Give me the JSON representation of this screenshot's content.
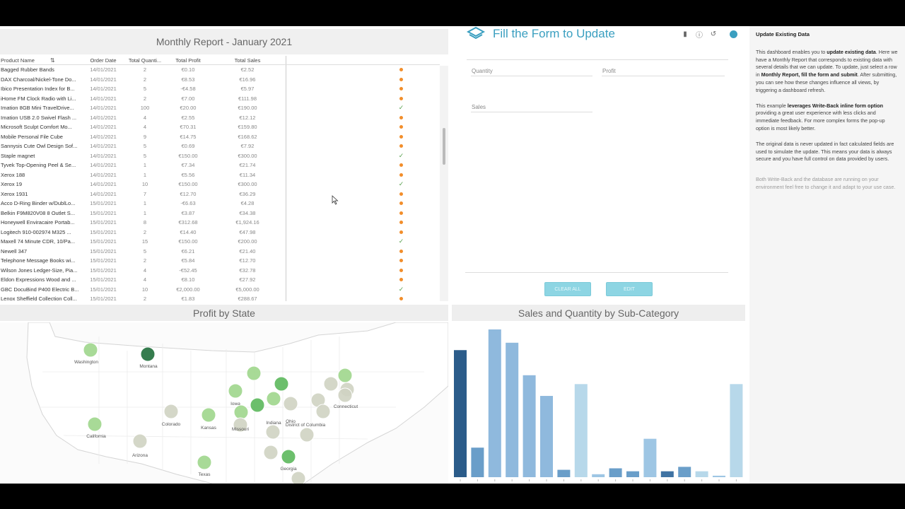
{
  "report": {
    "title": "Monthly Report  - January 2021",
    "columns": [
      "Product Name",
      "Order Date",
      "Total Quanti...",
      "Total Profit",
      "Total Sales"
    ],
    "rows": [
      {
        "name": "Bagged Rubber Bands",
        "date": "14/01/2021",
        "qty": "2",
        "profit": "€0.10",
        "sales": "€2.52",
        "status": "dot"
      },
      {
        "name": "DAX Charcoal/Nickel-Tone Do...",
        "date": "14/01/2021",
        "qty": "2",
        "profit": "€8.53",
        "sales": "€16.96",
        "status": "dot"
      },
      {
        "name": "Ibico Presentation Index for B...",
        "date": "14/01/2021",
        "qty": "5",
        "profit": "-€4.58",
        "sales": "€5.97",
        "status": "dot"
      },
      {
        "name": "iHome FM Clock Radio with Li...",
        "date": "14/01/2021",
        "qty": "2",
        "profit": "€7.00",
        "sales": "€111.98",
        "status": "dot"
      },
      {
        "name": "Imation 8GB Mini TravelDrive...",
        "date": "14/01/2021",
        "qty": "100",
        "profit": "€20.00",
        "sales": "€190.00",
        "status": "check"
      },
      {
        "name": "Imation USB 2.0 Swivel Flash ...",
        "date": "14/01/2021",
        "qty": "4",
        "profit": "€2.55",
        "sales": "€12.12",
        "status": "dot"
      },
      {
        "name": "Microsoft Sculpt Comfort Mo...",
        "date": "14/01/2021",
        "qty": "4",
        "profit": "€70.31",
        "sales": "€159.80",
        "status": "dot"
      },
      {
        "name": "Mobile Personal File Cube",
        "date": "14/01/2021",
        "qty": "9",
        "profit": "€14.75",
        "sales": "€168.62",
        "status": "dot"
      },
      {
        "name": "Sannysis Cute Owl Design Sof...",
        "date": "14/01/2021",
        "qty": "5",
        "profit": "€0.69",
        "sales": "€7.92",
        "status": "dot"
      },
      {
        "name": "Staple magnet",
        "date": "14/01/2021",
        "qty": "5",
        "profit": "€150.00",
        "sales": "€300.00",
        "status": "check"
      },
      {
        "name": "Tyvek  Top-Opening Peel & Se...",
        "date": "14/01/2021",
        "qty": "1",
        "profit": "€7.34",
        "sales": "€21.74",
        "status": "dot"
      },
      {
        "name": "Xerox 188",
        "date": "14/01/2021",
        "qty": "1",
        "profit": "€5.56",
        "sales": "€11.34",
        "status": "dot"
      },
      {
        "name": "Xerox 19",
        "date": "14/01/2021",
        "qty": "10",
        "profit": "€150.00",
        "sales": "€300.00",
        "status": "check"
      },
      {
        "name": "Xerox 1931",
        "date": "14/01/2021",
        "qty": "7",
        "profit": "€12.70",
        "sales": "€36.29",
        "status": "dot"
      },
      {
        "name": "Acco D-Ring Binder w/DublLo...",
        "date": "15/01/2021",
        "qty": "1",
        "profit": "-€6.63",
        "sales": "€4.28",
        "status": "dot"
      },
      {
        "name": "Belkin F9M820V08 8 Outlet S...",
        "date": "15/01/2021",
        "qty": "1",
        "profit": "€3.87",
        "sales": "€34.38",
        "status": "dot"
      },
      {
        "name": "Honeywell Enviracaire Portab...",
        "date": "15/01/2021",
        "qty": "8",
        "profit": "€312.68",
        "sales": "€1,924.16",
        "status": "dot"
      },
      {
        "name": "Logitech 910-002974 M325 ...",
        "date": "15/01/2021",
        "qty": "2",
        "profit": "€14.40",
        "sales": "€47.98",
        "status": "dot"
      },
      {
        "name": "Maxell 74 Minute CDR, 10/Pa...",
        "date": "15/01/2021",
        "qty": "15",
        "profit": "€150.00",
        "sales": "€200.00",
        "status": "check"
      },
      {
        "name": "Newell 347",
        "date": "15/01/2021",
        "qty": "5",
        "profit": "€6.21",
        "sales": "€21.40",
        "status": "dot"
      },
      {
        "name": "Telephone Message Books wi...",
        "date": "15/01/2021",
        "qty": "2",
        "profit": "€5.84",
        "sales": "€12.70",
        "status": "dot"
      },
      {
        "name": "Wilson Jones Ledger-Size, Pia...",
        "date": "15/01/2021",
        "qty": "4",
        "profit": "-€52.45",
        "sales": "€32.78",
        "status": "dot"
      },
      {
        "name": "Eldon Expressions Wood and ...",
        "date": "15/01/2021",
        "qty": "4",
        "profit": "€8.10",
        "sales": "€27.92",
        "status": "dot"
      },
      {
        "name": "GBC DocuBind P400 Electric B...",
        "date": "15/01/2021",
        "qty": "10",
        "profit": "€2,000.00",
        "sales": "€5,000.00",
        "status": "check"
      },
      {
        "name": "Lenox Sheffield Collection Coll...",
        "date": "15/01/2021",
        "qty": "2",
        "profit": "€1.83",
        "sales": "€288.67",
        "status": "dot"
      }
    ]
  },
  "form": {
    "title": "Fill the Form to Update",
    "fields": {
      "quantity": "Quantity",
      "profit": "Profit",
      "sales": "Sales"
    },
    "clear_label": "CLEAR ALL",
    "submit_label": "EDIT"
  },
  "info": {
    "title": "Update Existing Data",
    "p1_a": "This dashboard enables you to ",
    "p1_b": "update existing data",
    "p1_c": ". Here we have a Monthly Report that corresponds to existing data with several details that we can update. To update, just select a row in ",
    "p1_d": "Monthly Report, fill the form and submit",
    "p1_e": ". After submitting, you can see how these changes influence all views, by triggering a dashboard refresh.",
    "p2_a": "This example ",
    "p2_b": "leverages Write-Back inline form option",
    "p2_c": " providing a great user experience with less clicks and immediate feedback. For more complex forms the pop-up option is most likely better.",
    "p3": "The original data is never updated in fact calculated fields are used to simulate the update. This means your data is always secure and you have full control on data provided by users.",
    "p4": "Both Write-Back and the database are running on your environment feel free to change it and adapt to your use case."
  },
  "map": {
    "title": "Profit by State",
    "labels": [
      {
        "text": "Washington"
      },
      {
        "text": "Montana"
      },
      {
        "text": "Iowa"
      },
      {
        "text": "Indiana"
      },
      {
        "text": "Ohio"
      },
      {
        "text": "Connecticut"
      },
      {
        "text": "Colorado"
      },
      {
        "text": "Kansas"
      },
      {
        "text": "Missouri"
      },
      {
        "text": "District of Columbia"
      },
      {
        "text": "California"
      },
      {
        "text": "Arizona"
      },
      {
        "text": "Georgia"
      },
      {
        "text": "Texas"
      }
    ],
    "colors": {
      "light": "#9fd68c",
      "mid": "#5cb85c",
      "dark": "#1f6e3b",
      "neutral": "#cfd3c2"
    }
  },
  "bars": {
    "title": "Sales and Quantity by Sub-Category"
  },
  "chart_data": {
    "type": "bar",
    "title": "Sales and Quantity by Sub-Category",
    "values": [
      0.86,
      0.2,
      1.0,
      0.91,
      0.69,
      0.55,
      0.05,
      0.63,
      0.02,
      0.06,
      0.04,
      0.26,
      0.04,
      0.07,
      0.04,
      0.01,
      0.63
    ],
    "colors": [
      "#2b5c8a",
      "#6a9ec9",
      "#8fb9dd",
      "#8fb9dd",
      "#8fb9dd",
      "#8fb9dd",
      "#6a9ec9",
      "#b7d8ea",
      "#9ec6e4",
      "#6a9ec9",
      "#6a9ec9",
      "#9ec6e4",
      "#3f73a3",
      "#6a9ec9",
      "#b7d8ea",
      "#9ec6e4",
      "#b7d8ea"
    ]
  }
}
